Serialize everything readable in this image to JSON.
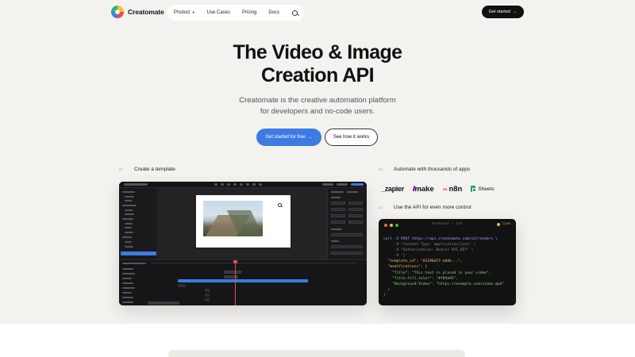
{
  "nav": {
    "brand": "Creatomate",
    "menu": [
      {
        "label": "Product",
        "has_caret": true
      },
      {
        "label": "Use Cases"
      },
      {
        "label": "Pricing"
      },
      {
        "label": "Docs"
      }
    ],
    "cta": "Get started",
    "cta_arrow": "→"
  },
  "hero": {
    "title_line1": "The Video & Image",
    "title_line2": "Creation API",
    "subtitle_line1": "Creatomate is the creative automation platform",
    "subtitle_line2": "for developers and no-code users.",
    "primary_cta": "Get started for free",
    "primary_arrow": "→",
    "secondary_cta": "See how it works"
  },
  "steps": [
    {
      "num": "01",
      "label": "Create a template"
    },
    {
      "num": "02",
      "label": "Automate with thousands of apps"
    },
    {
      "num": "03",
      "label": "Use the API for even more control"
    }
  ],
  "integrations": {
    "zapier": "_zapier",
    "make": "make",
    "n8n": "n8n",
    "sheets": "Sheets"
  },
  "terminal": {
    "title": "terminal — zsh",
    "live": "live",
    "dot_colors": [
      "#ff5f57",
      "#febc2e",
      "#28c840"
    ],
    "lines": [
      "curl -X POST https://api.creatomate.com/v2/renders \\",
      "     -H \"Content-Type: application/json\" \\",
      "     -H \"Authorization: Bearer API_KEY\" \\",
      "     -d '{",
      "  \"template_id\": \"03298a57-a04b...\",",
      "  \"modifications\": {",
      "    \"Title\": \"This text is placed in your video\",",
      "    \"Title.fill_color\": \"#f89a95\",",
      "    \"Background-Video\": \"https://example.com/video.mp4\"",
      "  }",
      "}'"
    ]
  },
  "colors": {
    "accent": "#3d7be3",
    "background": "#f3f2ee",
    "dark": "#111111"
  }
}
